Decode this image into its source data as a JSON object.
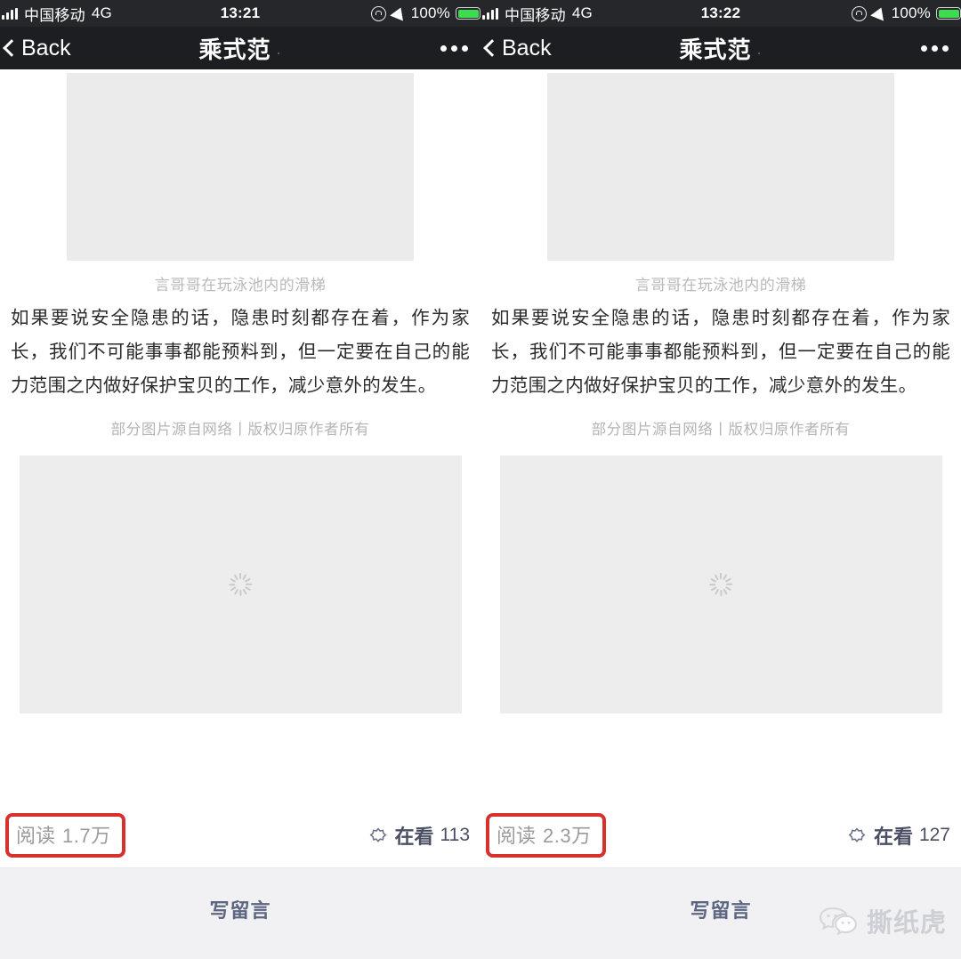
{
  "colors": {
    "status_bar_bg": "#26272b",
    "nav_bar_bg": "#1d1e22",
    "page_bg": "#ffffff",
    "image_placeholder": "#ebebeb",
    "highlight_box_border": "#d6312c",
    "read_text": "#9b9b9b",
    "wow_text": "#4a4f63",
    "comment_bar_bg": "#f1f1f3",
    "comment_link_text": "#5d6680",
    "battery_fill": "#3ddc4e",
    "watermark_text": "#c8cad0"
  },
  "panels": [
    {
      "status_bar": {
        "carrier": "中国移动",
        "network_type": "4G",
        "time": "13:21",
        "battery_percent": "100%",
        "icons": [
          "signal-bars-icon",
          "rotation-lock-icon",
          "location-arrow-icon",
          "battery-icon"
        ]
      },
      "nav_bar": {
        "back_label": "Back",
        "title": "乘式范",
        "title_tail": ".",
        "more_label": "•••"
      },
      "article": {
        "image_caption": "言哥哥在玩泳池内的滑梯",
        "paragraph": "如果要说安全隐患的话，隐患时刻都存在着，作为家长，我们不可能事事都能预料到，但一定要在自己的能力范围之内做好保护宝贝的工作，减少意外的发生。",
        "source_note": "部分图片源自网络丨版权归原作者所有"
      },
      "stats": {
        "read_label": "阅读",
        "read_value": "1.7万",
        "wow_label": "在看",
        "wow_value": "113",
        "wow_icon": "wow-flower-icon"
      },
      "comment_bar": {
        "write_comment_label": "写留言"
      }
    },
    {
      "status_bar": {
        "carrier": "中国移动",
        "network_type": "4G",
        "time": "13:22",
        "battery_percent": "100%",
        "icons": [
          "signal-bars-icon",
          "rotation-lock-icon",
          "location-arrow-icon",
          "battery-icon"
        ]
      },
      "nav_bar": {
        "back_label": "Back",
        "title": "乘式范",
        "title_tail": ".",
        "more_label": "•••"
      },
      "article": {
        "image_caption": "言哥哥在玩泳池内的滑梯",
        "paragraph": "如果要说安全隐患的话，隐患时刻都存在着，作为家长，我们不可能事事都能预料到，但一定要在自己的能力范围之内做好保护宝贝的工作，减少意外的发生。",
        "source_note": "部分图片源自网络丨版权归原作者所有"
      },
      "stats": {
        "read_label": "阅读",
        "read_value": "2.3万",
        "wow_label": "在看",
        "wow_value": "127",
        "wow_icon": "wow-flower-icon"
      },
      "comment_bar": {
        "write_comment_label": "写留言"
      }
    }
  ],
  "watermark": {
    "text": "撕纸虎",
    "icon": "wechat-bubbles-icon"
  }
}
